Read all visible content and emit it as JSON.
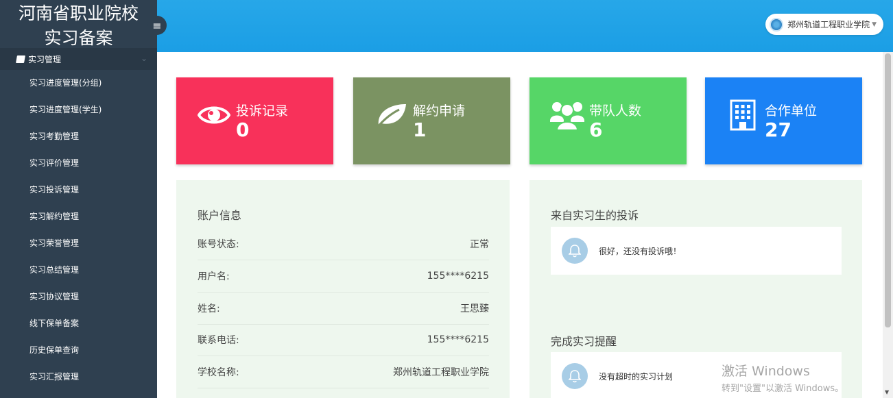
{
  "sidebar": {
    "brand_line1": "河南省职业院校",
    "brand_line2": "实习备案",
    "section_label": "实习管理",
    "items": [
      {
        "label": "实习进度管理(分组)"
      },
      {
        "label": "实习进度管理(学生)"
      },
      {
        "label": "实习考勤管理"
      },
      {
        "label": "实习评价管理"
      },
      {
        "label": "实习投诉管理"
      },
      {
        "label": "实习解约管理"
      },
      {
        "label": "实习荣誉管理"
      },
      {
        "label": "实习总结管理"
      },
      {
        "label": "实习协议管理"
      },
      {
        "label": "线下保单备案"
      },
      {
        "label": "历史保单查询"
      },
      {
        "label": "实习汇报管理"
      }
    ]
  },
  "header": {
    "user_school": "郑州轨道工程职业学院"
  },
  "stats": [
    {
      "label": "投诉记录",
      "value": "0",
      "icon": "eye-icon",
      "color": "#f8315a"
    },
    {
      "label": "解约申请",
      "value": "1",
      "icon": "leaf-icon",
      "color": "#7b9362"
    },
    {
      "label": "带队人数",
      "value": "6",
      "icon": "users-icon",
      "color": "#56d667"
    },
    {
      "label": "合作单位",
      "value": "27",
      "icon": "building-icon",
      "color": "#1b82f5"
    }
  ],
  "account": {
    "title": "账户信息",
    "rows": [
      {
        "key": "账号状态:",
        "value": "正常"
      },
      {
        "key": "用户名:",
        "value": "155****6215"
      },
      {
        "key": "姓名:",
        "value": "王思臻"
      },
      {
        "key": "联系电话:",
        "value": "155****6215"
      },
      {
        "key": "学校名称:",
        "value": "郑州轨道工程职业学院"
      }
    ]
  },
  "complaints": {
    "title": "来自实习生的投诉",
    "message": "很好，还没有投诉哦！"
  },
  "reminders": {
    "title": "完成实习提醒",
    "message": "没有超时的实习计划"
  },
  "watermark": {
    "line1": "激活 Windows",
    "line2": "转到\"设置\"以激活 Windows。"
  }
}
